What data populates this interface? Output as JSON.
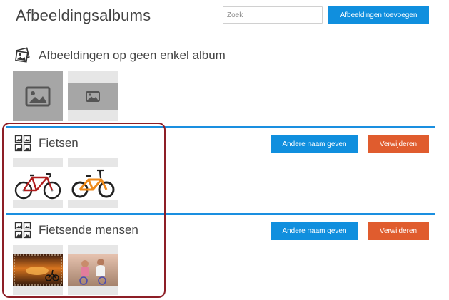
{
  "header": {
    "title": "Afbeeldingsalbums",
    "search_placeholder": "Zoek",
    "add_images_label": "Afbeeldingen toevoegen"
  },
  "unassigned": {
    "title": "Afbeeldingen op geen enkel album",
    "icon": "photos-stack-icon"
  },
  "albums": [
    {
      "title": "Fietsen",
      "rename_label": "Andere naam geven",
      "delete_label": "Verwijderen",
      "icon": "album-grid-icon",
      "images": [
        "road-bike-photo",
        "orange-bike-photo"
      ]
    },
    {
      "title": "Fietsende mensen",
      "rename_label": "Andere naam geven",
      "delete_label": "Verwijderen",
      "icon": "album-grid-icon",
      "images": [
        "sunset-cyclist-photo",
        "couple-cycling-photo"
      ]
    }
  ],
  "colors": {
    "primary_button": "#108fde",
    "delete_button": "#e05c2e",
    "divider": "#1a8fe0",
    "highlight_frame": "#8d1e26"
  }
}
